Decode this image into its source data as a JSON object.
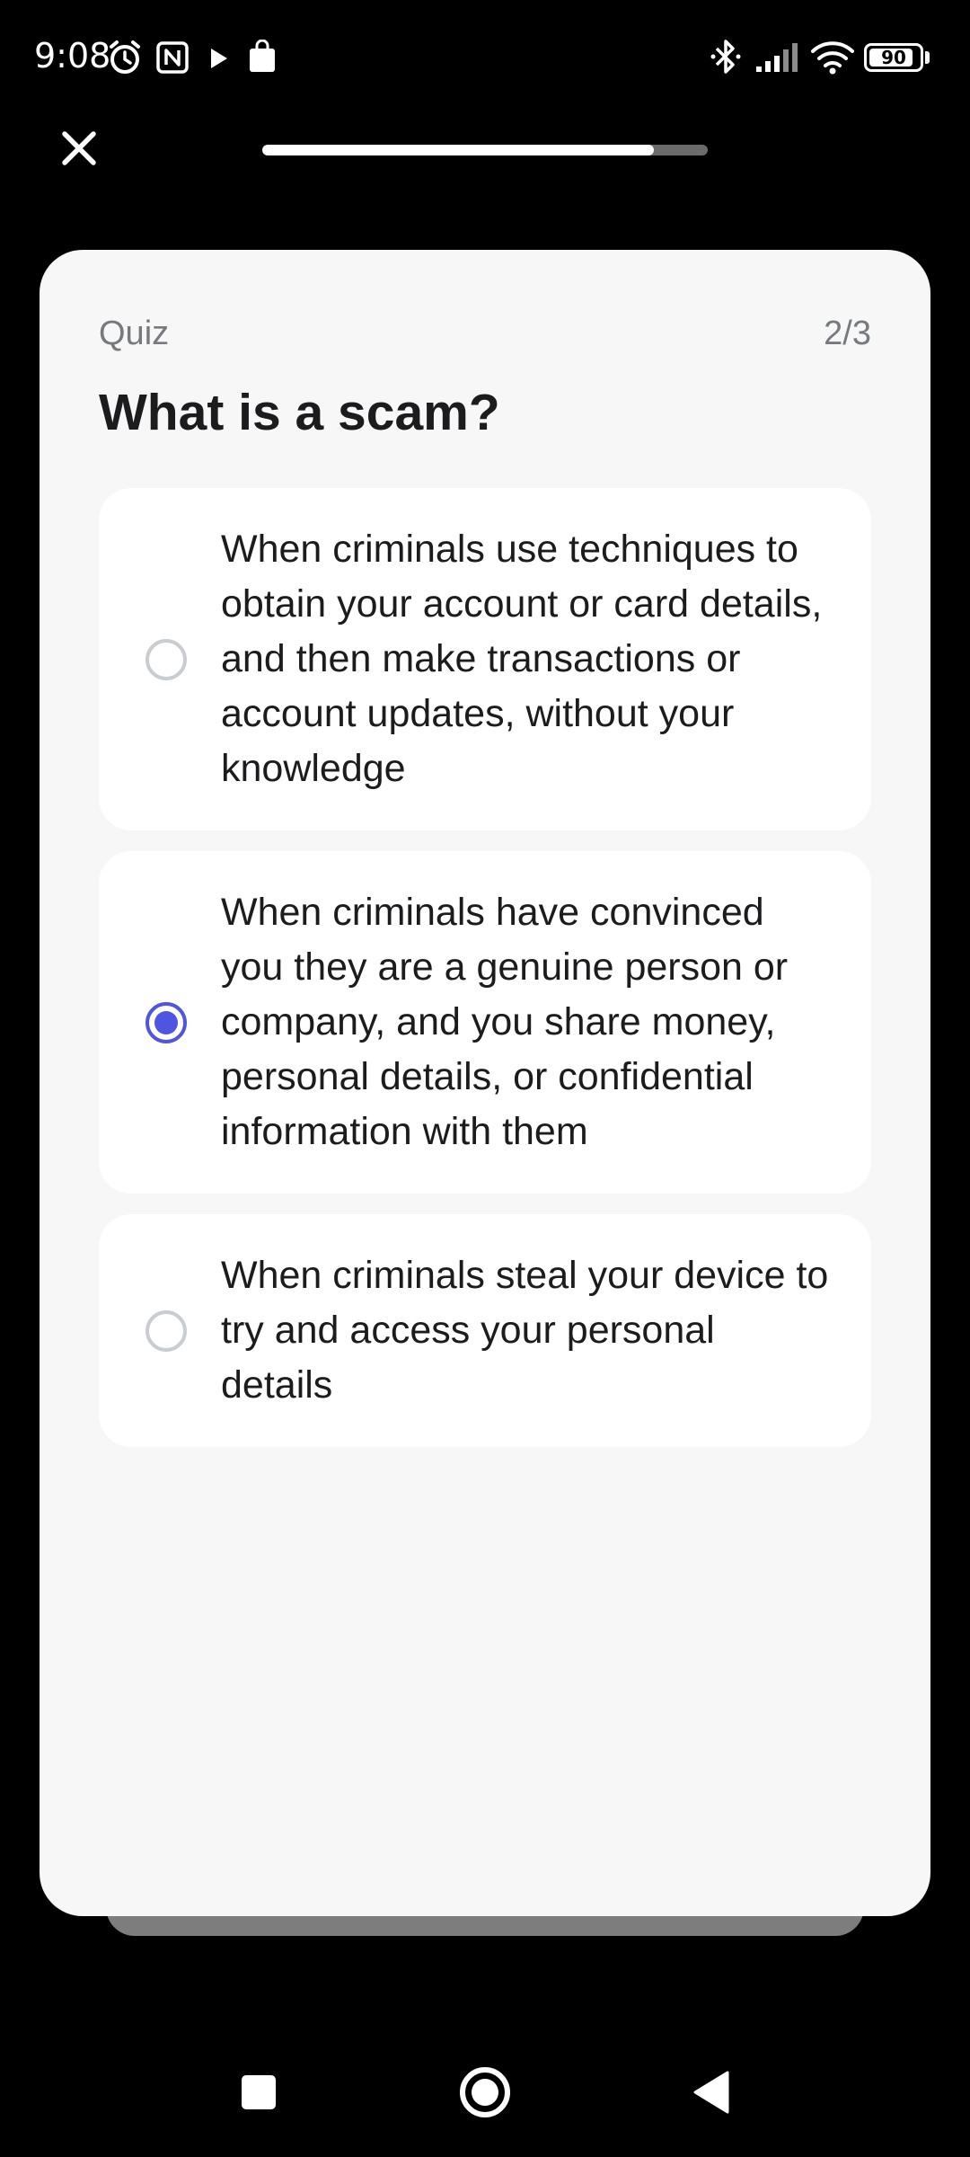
{
  "status_bar": {
    "time": "9:08",
    "battery": "90",
    "battery_level": 0.9
  },
  "header": {
    "progress": 0.88
  },
  "quiz": {
    "label": "Quiz",
    "step": "2/3",
    "question": "What is a scam?",
    "options": [
      {
        "text": "When criminals use techniques to obtain your account or card details, and then make transactions or account updates, without your knowledge",
        "selected": false
      },
      {
        "text": "When criminals have convinced you they are a genuine person or company, and you share money, personal details, or confidential information with them",
        "selected": true
      },
      {
        "text": "When criminals steal your device to try and access your personal details",
        "selected": false
      }
    ]
  },
  "colors": {
    "accent": "#4f55e0",
    "card_background": "#f7f7f7",
    "muted_text": "#76797e"
  },
  "icons": {
    "close": "close-icon",
    "alarm": "alarm-icon",
    "nfc": "nfc-icon",
    "play_store": "play-icon",
    "shopping": "shopping-bag-icon",
    "bluetooth": "bluetooth-icon",
    "signal": "signal-icon",
    "wifi": "wifi-icon",
    "battery": "battery-icon",
    "nav_recents": "square-icon",
    "nav_home": "circle-icon",
    "nav_back": "triangle-back-icon"
  }
}
